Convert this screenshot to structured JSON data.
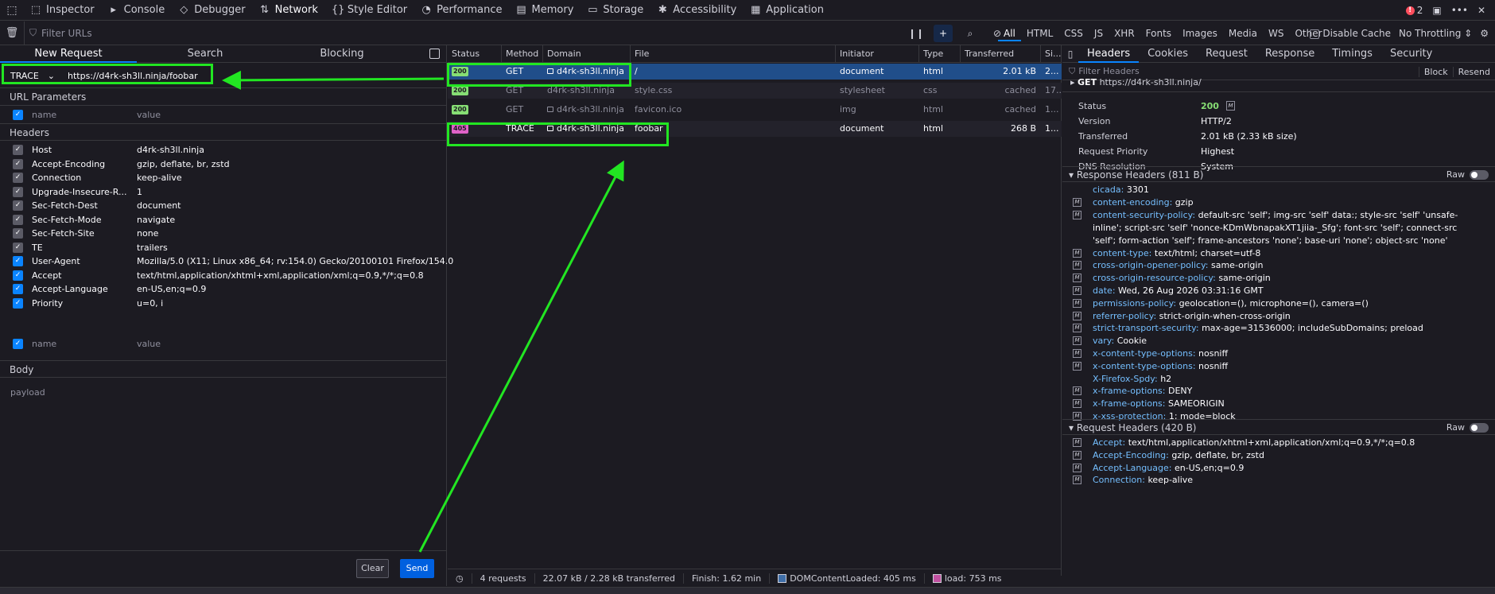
{
  "toolbar": {
    "tabs": [
      {
        "label": "Inspector",
        "icon": "inspector-icon",
        "glyph": "⬚"
      },
      {
        "label": "Console",
        "icon": "console-icon",
        "glyph": "▸"
      },
      {
        "label": "Debugger",
        "icon": "debugger-icon",
        "glyph": "◇"
      },
      {
        "label": "Network",
        "icon": "network-icon",
        "glyph": "⇅"
      },
      {
        "label": "Style Editor",
        "icon": "style-editor-icon",
        "glyph": "{}"
      },
      {
        "label": "Performance",
        "icon": "performance-icon",
        "glyph": "◔"
      },
      {
        "label": "Memory",
        "icon": "memory-icon",
        "glyph": "▤"
      },
      {
        "label": "Storage",
        "icon": "storage-icon",
        "glyph": "▭"
      },
      {
        "label": "Accessibility",
        "icon": "accessibility-icon",
        "glyph": "✱"
      },
      {
        "label": "Application",
        "icon": "application-icon",
        "glyph": "▦"
      }
    ],
    "active_tab": "Network",
    "error_count": "2"
  },
  "filterbar": {
    "placeholder": "Filter URLs",
    "types": [
      "All",
      "HTML",
      "CSS",
      "JS",
      "XHR",
      "Fonts",
      "Images",
      "Media",
      "WS",
      "Other"
    ],
    "active_type": "All",
    "disable_cache": "Disable Cache",
    "throttling": "No Throttling ⇕"
  },
  "left": {
    "tabs": [
      "New Request",
      "Search",
      "Blocking"
    ],
    "method": "TRACE",
    "url": "https://d4rk-sh3ll.ninja/foobar",
    "url_params_title": "URL Parameters",
    "param_name_placeholder": "name",
    "param_value_placeholder": "value",
    "headers_title": "Headers",
    "headers": [
      {
        "name": "Host",
        "value": "d4rk-sh3ll.ninja",
        "enabled": "dim"
      },
      {
        "name": "Accept-Encoding",
        "value": "gzip, deflate, br, zstd",
        "enabled": "dim"
      },
      {
        "name": "Connection",
        "value": "keep-alive",
        "enabled": "dim"
      },
      {
        "name": "Upgrade-Insecure-R...",
        "value": "1",
        "enabled": "dim"
      },
      {
        "name": "Sec-Fetch-Dest",
        "value": "document",
        "enabled": "dim"
      },
      {
        "name": "Sec-Fetch-Mode",
        "value": "navigate",
        "enabled": "dim"
      },
      {
        "name": "Sec-Fetch-Site",
        "value": "none",
        "enabled": "dim"
      },
      {
        "name": "TE",
        "value": "trailers",
        "enabled": "dim"
      },
      {
        "name": "User-Agent",
        "value": "Mozilla/5.0 (X11; Linux x86_64; rv:154.0) Gecko/20100101 Firefox/154.0",
        "enabled": "on"
      },
      {
        "name": "Accept",
        "value": "text/html,application/xhtml+xml,application/xml;q=0.9,*/*;q=0.8",
        "enabled": "on"
      },
      {
        "name": "Accept-Language",
        "value": "en-US,en;q=0.9",
        "enabled": "on"
      },
      {
        "name": "Priority",
        "value": "u=0, i",
        "enabled": "on"
      }
    ],
    "header_name_placeholder": "name",
    "header_value_placeholder": "value",
    "body_title": "Body",
    "body_placeholder": "payload",
    "clear_label": "Clear",
    "send_label": "Send"
  },
  "requests": {
    "columns": [
      "Status",
      "Method",
      "Domain",
      "File",
      "Initiator",
      "Type",
      "Transferred",
      "Si..."
    ],
    "rows": [
      {
        "status": "200",
        "method": "GET",
        "domain": "d4rk-sh3ll.ninja",
        "secure": true,
        "file": "/",
        "initiator": "document",
        "type": "html",
        "transferred": "2.01 kB",
        "size": "2...",
        "state": "selected"
      },
      {
        "status": "200",
        "method": "GET",
        "domain": "d4rk-sh3ll.ninja",
        "secure": false,
        "file": "style.css",
        "initiator": "stylesheet",
        "type": "css",
        "transferred": "cached",
        "size": "17...",
        "state": "dim"
      },
      {
        "status": "200",
        "method": "GET",
        "domain": "d4rk-sh3ll.ninja",
        "secure": true,
        "file": "favicon.ico",
        "initiator": "img",
        "type": "html",
        "transferred": "cached",
        "size": "1...",
        "state": "dim"
      },
      {
        "status": "405",
        "method": "TRACE",
        "domain": "d4rk-sh3ll.ninja",
        "secure": true,
        "file": "foobar",
        "initiator": "document",
        "type": "html",
        "transferred": "268 B",
        "size": "1...",
        "state": "normal"
      }
    ],
    "status_colors": {
      "200": "#86de74",
      "405": "#e062c8"
    }
  },
  "summary": {
    "requests": "4 requests",
    "transferred": "22.07 kB / 2.28 kB transferred",
    "finish": "Finish: 1.62 min",
    "dcl": "DOMContentLoaded: 405 ms",
    "load": "load: 753 ms"
  },
  "details": {
    "tabs": [
      "Headers",
      "Cookies",
      "Request",
      "Response",
      "Timings",
      "Security"
    ],
    "filter_placeholder": "Filter Headers",
    "block_label": "Block",
    "resend_label": "Resend",
    "method": "GET",
    "url": "https://d4rk-sh3ll.ninja/",
    "status_rows": [
      {
        "k": "Status",
        "v": "200"
      },
      {
        "k": "Version",
        "v": "HTTP/2"
      },
      {
        "k": "Transferred",
        "v": "2.01 kB (2.33 kB size)"
      },
      {
        "k": "Request Priority",
        "v": "Highest"
      },
      {
        "k": "DNS Resolution",
        "v": "System"
      }
    ],
    "response_title": "Response Headers (811 B)",
    "request_title": "Request Headers (420 B)",
    "raw_label": "Raw",
    "response_headers": [
      {
        "k": "cicada",
        "v": "3301",
        "mdn": false
      },
      {
        "k": "content-encoding",
        "v": "gzip",
        "mdn": true
      },
      {
        "k": "content-security-policy",
        "v": "default-src 'self'; img-src 'self' data:; style-src 'self' 'unsafe-inline'; script-src 'self' 'nonce-KDmWbnapakXT1jiia-_Sfg'; font-src 'self'; connect-src 'self'; form-action 'self'; frame-ancestors 'none'; base-uri 'none'; object-src 'none'",
        "mdn": true
      },
      {
        "k": "content-type",
        "v": "text/html; charset=utf-8",
        "mdn": true
      },
      {
        "k": "cross-origin-opener-policy",
        "v": "same-origin",
        "mdn": true
      },
      {
        "k": "cross-origin-resource-policy",
        "v": "same-origin",
        "mdn": true
      },
      {
        "k": "date",
        "v": "Wed, 26 Aug 2026 03:31:16 GMT",
        "mdn": true
      },
      {
        "k": "permissions-policy",
        "v": "geolocation=(), microphone=(), camera=()",
        "mdn": true
      },
      {
        "k": "referrer-policy",
        "v": "strict-origin-when-cross-origin",
        "mdn": true
      },
      {
        "k": "strict-transport-security",
        "v": "max-age=31536000; includeSubDomains; preload",
        "mdn": true
      },
      {
        "k": "vary",
        "v": "Cookie",
        "mdn": true
      },
      {
        "k": "x-content-type-options",
        "v": "nosniff",
        "mdn": true
      },
      {
        "k": "x-content-type-options",
        "v": "nosniff",
        "mdn": true
      },
      {
        "k": "X-Firefox-Spdy",
        "v": "h2",
        "mdn": false
      },
      {
        "k": "x-frame-options",
        "v": "DENY",
        "mdn": true
      },
      {
        "k": "x-frame-options",
        "v": "SAMEORIGIN",
        "mdn": true
      },
      {
        "k": "x-xss-protection",
        "v": "1; mode=block",
        "mdn": true
      }
    ],
    "request_headers": [
      {
        "k": "Accept",
        "v": "text/html,application/xhtml+xml,application/xml;q=0.9,*/*;q=0.8",
        "mdn": true
      },
      {
        "k": "Accept-Encoding",
        "v": "gzip, deflate, br, zstd",
        "mdn": true
      },
      {
        "k": "Accept-Language",
        "v": "en-US,en;q=0.9",
        "mdn": true
      },
      {
        "k": "Connection",
        "v": "keep-alive",
        "mdn": true
      }
    ]
  },
  "colors": {
    "accent": "#0a84ff",
    "annotation": "#22e622",
    "selected_row": "#204e8a"
  }
}
